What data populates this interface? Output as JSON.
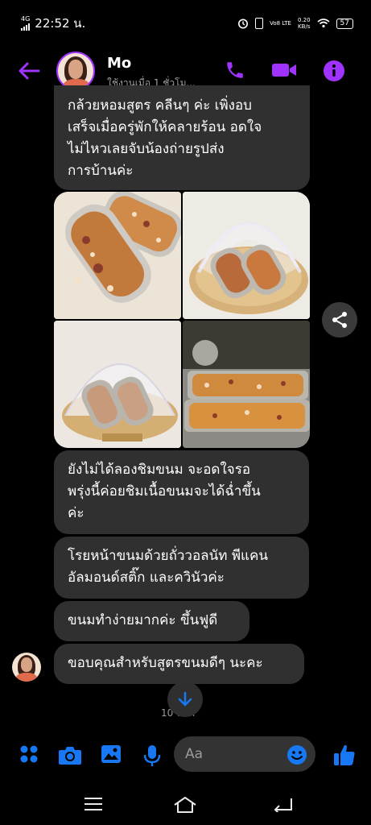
{
  "status_bar": {
    "network": "4G",
    "time": "22:52 น.",
    "volte": "Vo8 LTE",
    "speed_value": "0.20",
    "speed_unit": "KB/s",
    "battery": "57"
  },
  "header": {
    "contact_name": "Mo",
    "contact_status": "ใช้งานเมื่อ 1 ชั่วโม...",
    "accent_color": "#a033ff"
  },
  "messages": [
    {
      "text": "กล้วยหอมสูตร คลีนๆ ค่ะ เพิ่งอบ\nเสร็จเมื่อครู่พักให้คลายร้อน อดใจ\nไม่ไหวเลยจับน้องถ่ายรูปส่ง\nการบ้านค่ะ"
    },
    {
      "text": "ยังไม่ได้ลองชิมขนม จะอดใจรอ\nพรุ่งนี้ค่อยชิมเนื้อขนมจะได้ฉ่ำขึ้น\nค่ะ"
    },
    {
      "text": "โรยหน้าขนมด้วยถั่ววอลนัท พีแคน\nอัลมอนด์สติ๊ก และควินัวค่ะ"
    },
    {
      "text": "ขนมทำง่ายมากค่ะ ขึ้นฟูดี"
    },
    {
      "text": "ขอบคุณสำหรับสูตรขนมดีๆ นะคะ"
    }
  ],
  "timestamp": "10 นาที",
  "composer": {
    "placeholder": "Aa"
  },
  "icons": {
    "back": "arrow-left-icon",
    "call": "phone-icon",
    "video": "video-camera-icon",
    "info": "info-icon",
    "share": "share-icon",
    "scroll_down": "arrow-down-icon",
    "menu": "four-dots-icon",
    "camera": "camera-icon",
    "gallery": "image-icon",
    "mic": "microphone-icon",
    "emoji": "smiley-icon",
    "like": "thumbs-up-icon",
    "nav_recents": "menu-lines-icon",
    "nav_home": "home-icon",
    "nav_back": "back-return-icon"
  },
  "colors": {
    "composer_blue": "#1877f2",
    "bubble": "#303030"
  }
}
